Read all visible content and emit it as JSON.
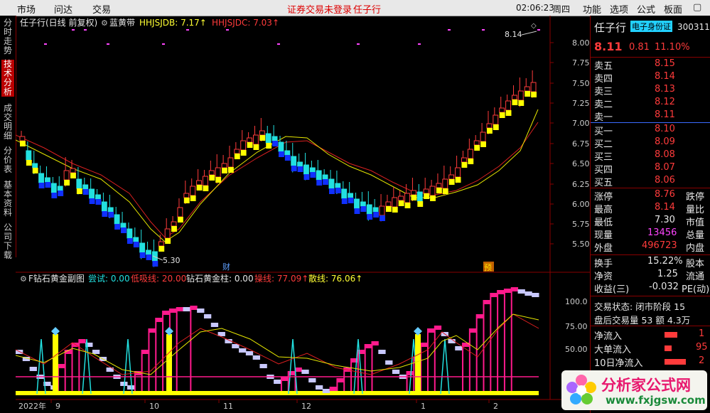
{
  "menu": {
    "items": [
      "市场",
      "问达",
      "交易"
    ],
    "login_notice": "证券交易未登录",
    "user_name": "任子行",
    "time": "02:06:23",
    "weekday": "周四",
    "right_items": [
      "功能",
      "选项",
      "公式",
      "板面"
    ]
  },
  "left_tabs": [
    "分时走势",
    "技术分析",
    "成交明细",
    "分价表",
    "基本资料",
    "公司下载"
  ],
  "main_chart": {
    "title": "任子行(日线 前复权)",
    "indicator_name": "蓝黄带",
    "hhjsjdb": "HHJSJDB: 7.17↑",
    "hhjsjdc": "HHJSJDC: 7.03↑",
    "high_label": "8.14",
    "low_label": "5.30",
    "marker_cai": "财",
    "marker_yu": "预",
    "y_ticks": [
      "8.00",
      "7.75",
      "7.50",
      "7.25",
      "7.00",
      "6.75",
      "6.50",
      "6.25",
      "6.00",
      "5.75",
      "5.50"
    ]
  },
  "sub_chart": {
    "title": "F钻石黄金副图",
    "trial": "尝试: 0.00",
    "low_suck": "低吸线: 20.00",
    "diamond": "钻石黄金柱: 0.00",
    "control": "操线: 77.09↑",
    "scatter": "散线: 76.06↑",
    "y_ticks": [
      "100.0",
      "75.00",
      "50.00"
    ]
  },
  "x_axis": [
    "2022年",
    "9",
    "10",
    "11",
    "12",
    "1",
    "2"
  ],
  "quote": {
    "name": "任子行",
    "tag": "电子身份证",
    "code": "300311",
    "price": "8.11",
    "change": "0.81",
    "pct": "11.10%",
    "asks": [
      {
        "label": "卖五",
        "price": "8.15"
      },
      {
        "label": "卖四",
        "price": "8.14"
      },
      {
        "label": "卖三",
        "price": "8.13"
      },
      {
        "label": "卖二",
        "price": "8.12"
      },
      {
        "label": "卖一",
        "price": "8.11"
      }
    ],
    "bids": [
      {
        "label": "买一",
        "price": "8.10"
      },
      {
        "label": "买二",
        "price": "8.09"
      },
      {
        "label": "买三",
        "price": "8.08"
      },
      {
        "label": "买四",
        "price": "8.07"
      },
      {
        "label": "买五",
        "price": "8.06"
      }
    ],
    "stats": [
      {
        "k": "涨停",
        "v": "8.76",
        "k2": "跌停"
      },
      {
        "k": "最高",
        "v": "8.14",
        "k2": "量比"
      },
      {
        "k": "最低",
        "v": "7.30",
        "k2": "市值"
      },
      {
        "k": "现量",
        "v": "13456",
        "k2": "总量"
      },
      {
        "k": "外盘",
        "v": "496723",
        "k2": "内盘"
      }
    ],
    "turnover": {
      "k": "换手",
      "v": "15.22%",
      "k2": "股本"
    },
    "net_asset": {
      "k": "净资",
      "v": "1.25",
      "k2": "流通"
    },
    "eps": {
      "k": "收益(三)",
      "v": "-0.032",
      "k2": "PE(动)"
    },
    "trade_status": "交易状态: 闭市阶段 15",
    "after_hours": "盘后交易量 53 额 4.3万",
    "flows": [
      {
        "k": "净流入",
        "v": "1"
      },
      {
        "k": "大单流入",
        "v": "95"
      },
      {
        "k": "10日净流入",
        "v": "2"
      }
    ]
  },
  "watermark": {
    "text": "分析家公式网",
    "url": "www.fxjgsw.com"
  },
  "colors": {
    "up": "#ff3b3b",
    "down": "#22e0e0",
    "yellow": "#ffff00",
    "blue": "#1030ff",
    "magenta": "#ff1a8c",
    "lavender": "#c8c8ff"
  }
}
